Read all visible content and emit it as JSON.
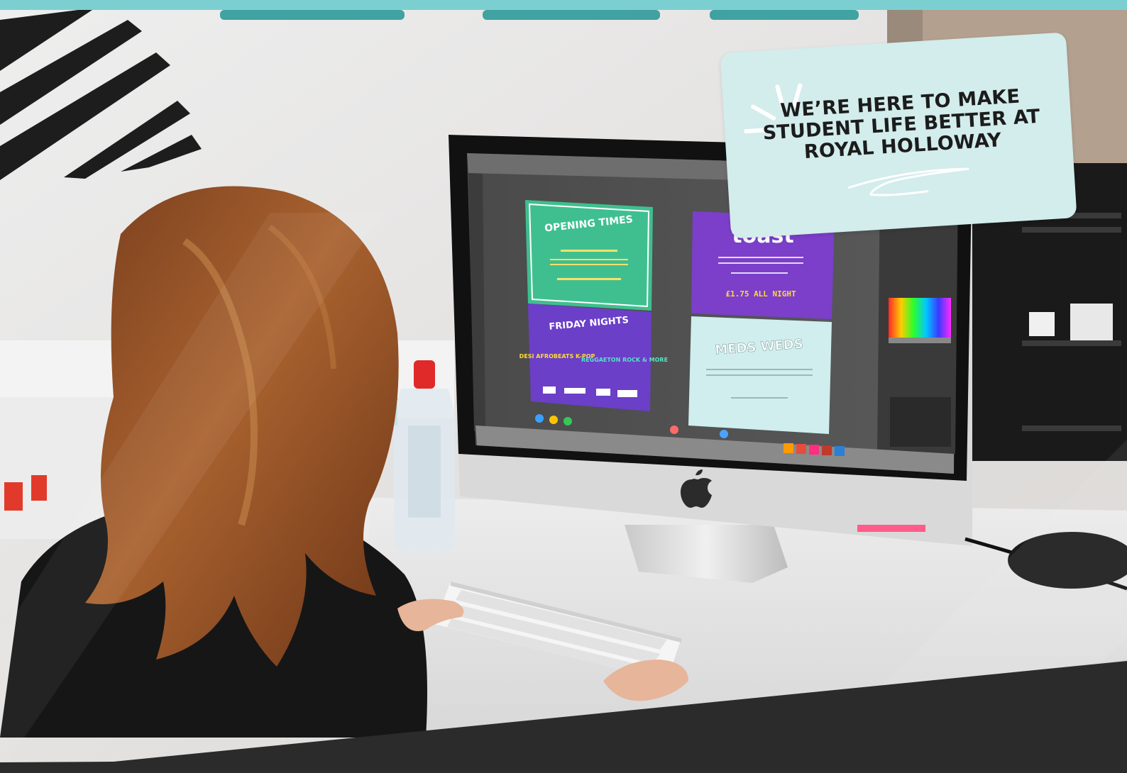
{
  "banner": {
    "tagline": "WE’RE HERE TO MAKE STUDENT LIFE BETTER AT ROYAL HOLLOWAY",
    "card_color": "#d3ecec",
    "top_band_color": "#7ccfd0",
    "bottom_band_color": "#2b2b2b"
  },
  "photo": {
    "screen_posters": [
      {
        "title": "OPENING TIMES",
        "color": "#3fbf8f"
      },
      {
        "title": "toast",
        "color": "#7b3fc9"
      },
      {
        "title": "FRIDAY NIGHTS",
        "color": "#6b3fc8"
      },
      {
        "title": "MEDS WEDS",
        "color": "#cfeeed"
      }
    ],
    "poster_lines": {
      "friday_left": "DESI AFROBEATS K-POP",
      "friday_right": "REGGAETON ROCK & MORE",
      "toast_price": "£1.75 ALL NIGHT"
    }
  }
}
